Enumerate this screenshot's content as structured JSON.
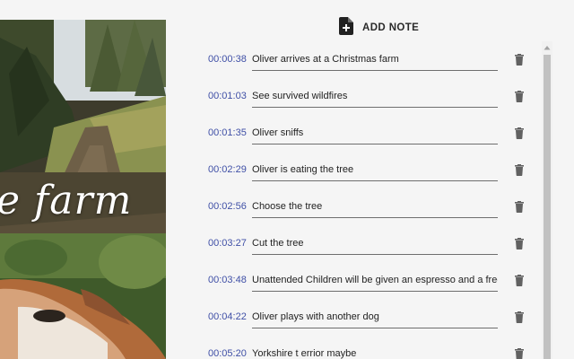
{
  "video": {
    "caption": "e farm"
  },
  "header": {
    "add_note_label": "ADD NOTE",
    "add_note_icon": "note-add-icon"
  },
  "notes": [
    {
      "timestamp": "00:00:38",
      "text": "Oliver arrives at a Christmas farm"
    },
    {
      "timestamp": "00:01:03",
      "text": "See survived wildfires"
    },
    {
      "timestamp": "00:01:35",
      "text": "Oliver sniffs"
    },
    {
      "timestamp": "00:02:29",
      "text": "Oliver is eating the tree"
    },
    {
      "timestamp": "00:02:56",
      "text": "Choose the tree"
    },
    {
      "timestamp": "00:03:27",
      "text": "Cut the tree"
    },
    {
      "timestamp": "00:03:48",
      "text": "Unattended Children will be given an espresso and a free puppy"
    },
    {
      "timestamp": "00:04:22",
      "text": "Oliver plays with another dog"
    },
    {
      "timestamp": "00:05:20",
      "text": "Yorkshire t errior maybe"
    }
  ],
  "colors": {
    "timestamp": "#3f4fa6",
    "icon": "#616161",
    "scrollbar_thumb": "#c1c1c1"
  }
}
